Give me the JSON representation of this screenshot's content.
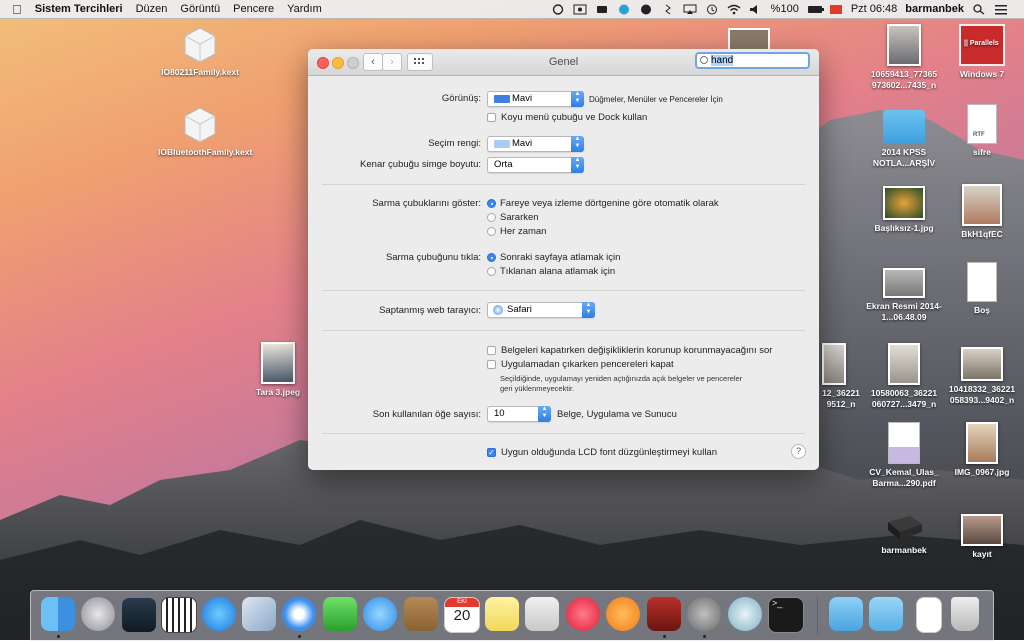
{
  "menubar": {
    "apple": "",
    "app": "Sistem Tercihleri",
    "items": [
      "Düzen",
      "Görüntü",
      "Pencere",
      "Yardım"
    ],
    "battery": "%100",
    "clock": "Pzt 06:48",
    "user": "barmanbek"
  },
  "desktop_icons": {
    "io80211": "IO80211Family.kext",
    "iobluetooth": "IOBluetoothFamily.kext",
    "tara": "Tara 3.jpeg",
    "img1": "10659413_77365 973602...7435_n",
    "parallels": "Windows 7",
    "parallels_logo": "|| Parallels",
    "kpss": "2014 KPSS NOTLA...ARŞİV",
    "sifre": "sifre",
    "rtf": "RTF",
    "basliksiz": "Başlıksız-1.jpg",
    "bkh": "BkH1qfEC",
    "ekran": "Ekran Resmi 2014-1...06.48.09",
    "bos": "Boş",
    "img2": "12_36221 9512_n",
    "img3": "10580063_36221 060727...3479_n",
    "img4": "10418332_36221 058393...9402_n",
    "cv": "CV_Kemal_Ulas_ Barma...290.pdf",
    "img0967": "IMG_0967.jpg",
    "barmanbek": "barmanbek",
    "kayit": "kayıt"
  },
  "window": {
    "title": "Genel",
    "search_value": "hand",
    "gorunus_label": "Görünüş:",
    "gorunus_value": "Mavi",
    "gorunus_desc": "Düğmeler, Menüler ve Pencereler İçin",
    "dark_menu": "Koyu menü çubuğu ve Dock kullan",
    "secim_label": "Seçim rengi:",
    "secim_value": "Mavi",
    "kenar_label": "Kenar çubuğu simge boyutu:",
    "kenar_value": "Orta",
    "sarma_goster_label": "Sarma çubuklarını göster:",
    "sarma_goster_options": [
      "Fareye veya izleme dörtgenine göre otomatik olarak",
      "Sararken",
      "Her zaman"
    ],
    "sarma_tikla_label": "Sarma çubuğunu tıkla:",
    "sarma_tikla_options": [
      "Sonraki sayfaya atlamak için",
      "Tıklanan alana atlamak için"
    ],
    "browser_label": "Saptanmış web tarayıcı:",
    "browser_value": "Safari",
    "ask_keep": "Belgeleri kapatırken değişikliklerin korunup korunmayacağını sor",
    "close_windows": "Uygulamadan çıkarken pencereleri kapat",
    "close_note": "Seçildiğinde, uygulamayı yeniden açtığınızda açık belgeler ve pencereler geri yüklenmeyecektir.",
    "recent_label": "Son kullanılan öğe sayısı:",
    "recent_value": "10",
    "recent_desc": "Belge, Uygulama ve Sunucu",
    "lcd": "Uygun olduğunda LCD font düzgünleştirmeyi kullan",
    "help": "?"
  },
  "dock": {
    "calendar_month": "EKİ",
    "calendar_day": "20"
  },
  "colors": {
    "accent": "#3b86ef",
    "blue_swatch": "#3f7fe0",
    "light_swatch": "#a9ccf2"
  }
}
